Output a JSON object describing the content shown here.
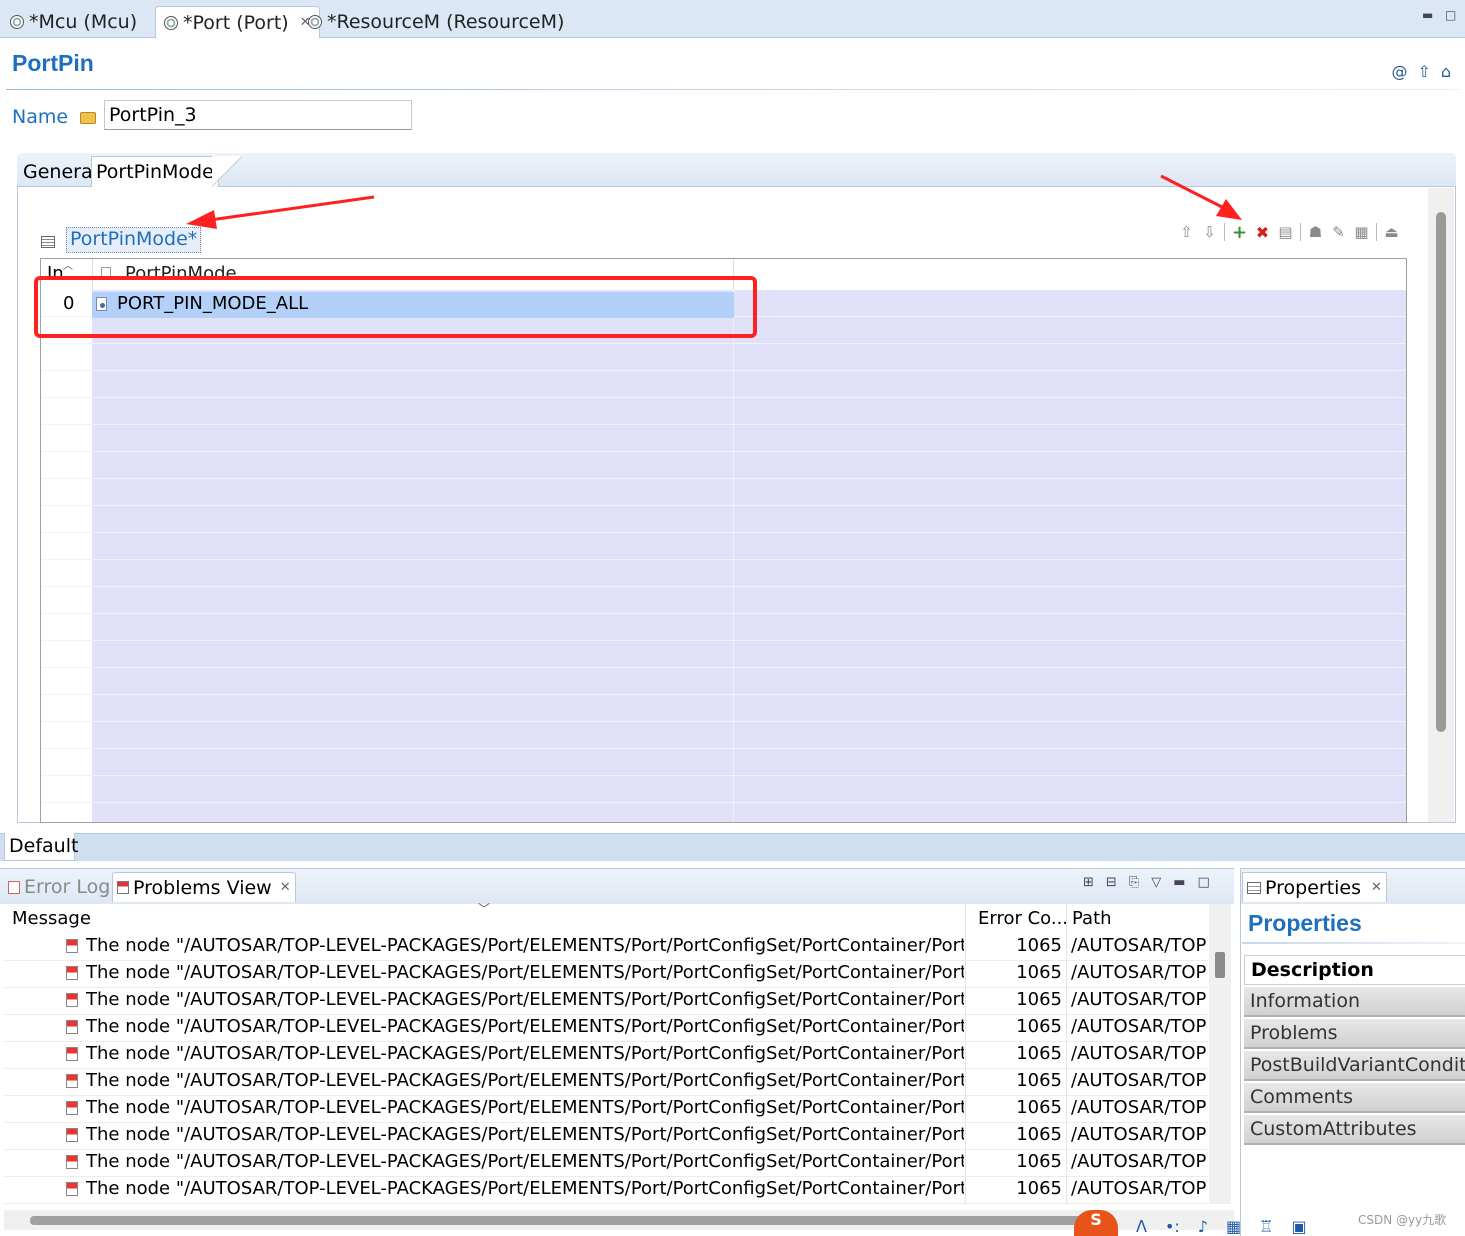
{
  "editor_tabs": [
    {
      "label": "*Mcu (Mcu)",
      "active": false
    },
    {
      "label": "*Port (Port)",
      "active": true
    },
    {
      "label": "*ResourceM (ResourceM)",
      "active": false
    }
  ],
  "editor": {
    "title": "PortPin",
    "name_label": "Name",
    "name_value": "PortPin_3",
    "inner_tabs": [
      "General",
      "PortPinMode"
    ],
    "section_title": "PortPinMode*",
    "table": {
      "columns": [
        "In...",
        "PortPinMode"
      ],
      "rows": [
        {
          "index": "0",
          "value": "PORT_PIN_MODE_ALL"
        }
      ]
    },
    "bottom_tab": "Default"
  },
  "bottom_views": {
    "tabs": [
      "Error Log",
      "Problems View"
    ],
    "columns": [
      "Message",
      "Error Co...",
      "Path"
    ],
    "rows": [
      {
        "message": "The node \"/AUTOSAR/TOP-LEVEL-PACKAGES/Port/ELEMENTS/Port/PortConfigSet/PortContainer/Port",
        "code": "1065",
        "path": "/AUTOSAR/TOP"
      },
      {
        "message": "The node \"/AUTOSAR/TOP-LEVEL-PACKAGES/Port/ELEMENTS/Port/PortConfigSet/PortContainer/Port",
        "code": "1065",
        "path": "/AUTOSAR/TOP"
      },
      {
        "message": "The node \"/AUTOSAR/TOP-LEVEL-PACKAGES/Port/ELEMENTS/Port/PortConfigSet/PortContainer/Port",
        "code": "1065",
        "path": "/AUTOSAR/TOP"
      },
      {
        "message": "The node \"/AUTOSAR/TOP-LEVEL-PACKAGES/Port/ELEMENTS/Port/PortConfigSet/PortContainer/Port",
        "code": "1065",
        "path": "/AUTOSAR/TOP"
      },
      {
        "message": "The node \"/AUTOSAR/TOP-LEVEL-PACKAGES/Port/ELEMENTS/Port/PortConfigSet/PortContainer/Port",
        "code": "1065",
        "path": "/AUTOSAR/TOP"
      },
      {
        "message": "The node \"/AUTOSAR/TOP-LEVEL-PACKAGES/Port/ELEMENTS/Port/PortConfigSet/PortContainer/Port",
        "code": "1065",
        "path": "/AUTOSAR/TOP"
      },
      {
        "message": "The node \"/AUTOSAR/TOP-LEVEL-PACKAGES/Port/ELEMENTS/Port/PortConfigSet/PortContainer/Port",
        "code": "1065",
        "path": "/AUTOSAR/TOP"
      },
      {
        "message": "The node \"/AUTOSAR/TOP-LEVEL-PACKAGES/Port/ELEMENTS/Port/PortConfigSet/PortContainer/Port",
        "code": "1065",
        "path": "/AUTOSAR/TOP"
      },
      {
        "message": "The node \"/AUTOSAR/TOP-LEVEL-PACKAGES/Port/ELEMENTS/Port/PortConfigSet/PortContainer/Port",
        "code": "1065",
        "path": "/AUTOSAR/TOP"
      },
      {
        "message": "The node \"/AUTOSAR/TOP-LEVEL-PACKAGES/Port/ELEMENTS/Port/PortConfigSet/PortContainer/Port",
        "code": "1065",
        "path": "/AUTOSAR/TOP"
      }
    ]
  },
  "properties": {
    "tab": "Properties",
    "title": "Properties",
    "items": [
      "Description",
      "Information",
      "Problems",
      "PostBuildVariantConditio",
      "Comments",
      "CustomAttributes"
    ]
  },
  "watermark": "CSDN @yy九歌",
  "colors": {
    "accent": "#1f6fbf",
    "selection": "#b3d1f8",
    "table_fill": "#e1e1fa",
    "annotation_red": "#ff2020"
  }
}
